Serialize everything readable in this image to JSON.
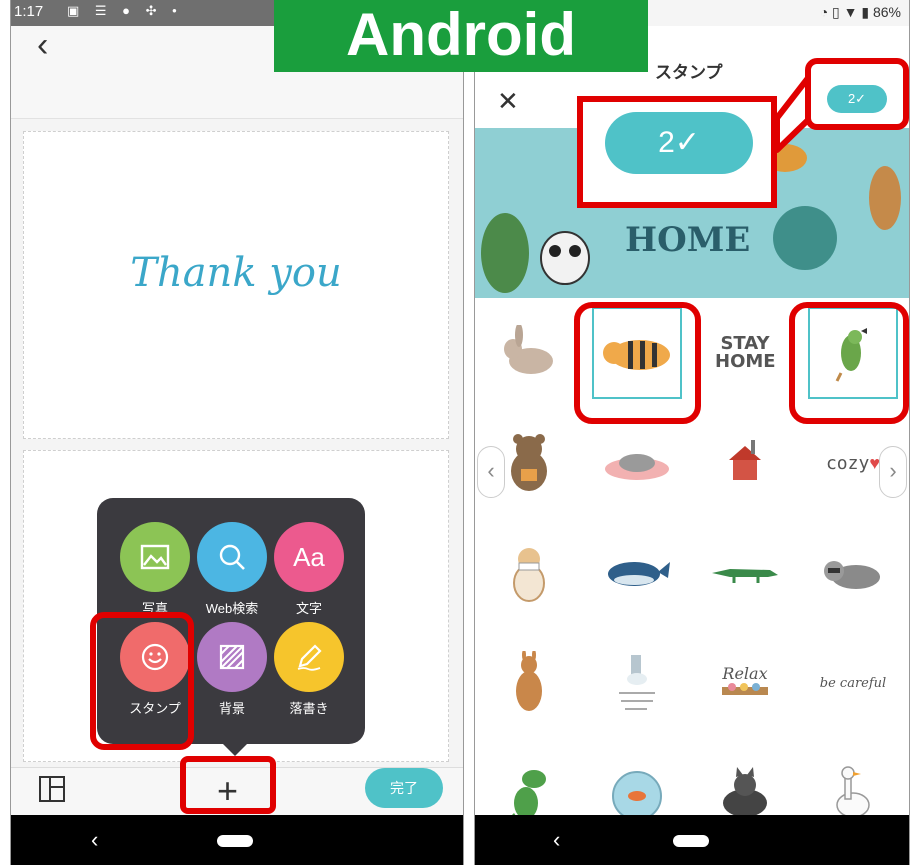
{
  "overlay_label": "Android",
  "left_phone": {
    "status": {
      "time": "1:17",
      "icons": "▣ ☰ ● ✣ •"
    },
    "card_text": "Thank you",
    "tools": [
      {
        "label": "写真",
        "color": "#8cc455"
      },
      {
        "label": "Web検索",
        "color": "#4cb6e3"
      },
      {
        "label": "文字",
        "color": "#ec5a8e"
      },
      {
        "label": "スタンプ",
        "color": "#f06b6b"
      },
      {
        "label": "背景",
        "color": "#b07ac4"
      },
      {
        "label": "落書き",
        "color": "#f6c52c"
      }
    ],
    "done_label": "完了",
    "plus_label": "+"
  },
  "right_phone": {
    "status": {
      "right": "86%"
    },
    "title": "スタンプ",
    "count_label": "2✓",
    "callout_count_label": "2✓",
    "banner_word": "HOME",
    "stickers": [
      {
        "name": "rabbit"
      },
      {
        "name": "tiger",
        "selected": true
      },
      {
        "name": "stay home",
        "text": "STAY HOME"
      },
      {
        "name": "parrot",
        "selected": true
      },
      {
        "name": "bear"
      },
      {
        "name": "cat sleeping"
      },
      {
        "name": "house"
      },
      {
        "name": "cozy",
        "text": "cozy"
      },
      {
        "name": "dog"
      },
      {
        "name": "whale"
      },
      {
        "name": "crocodile"
      },
      {
        "name": "raccoon"
      },
      {
        "name": "kangaroo"
      },
      {
        "name": "wash your hands"
      },
      {
        "name": "relax",
        "text": "Relax"
      },
      {
        "name": "be careful",
        "text": "be careful"
      },
      {
        "name": "dinosaur"
      },
      {
        "name": "fishbowl"
      },
      {
        "name": "cat"
      },
      {
        "name": "goose"
      }
    ]
  },
  "colors": {
    "accent": "#4fc2c8",
    "highlight": "#e00000",
    "banner_green": "#1a9e3d"
  }
}
